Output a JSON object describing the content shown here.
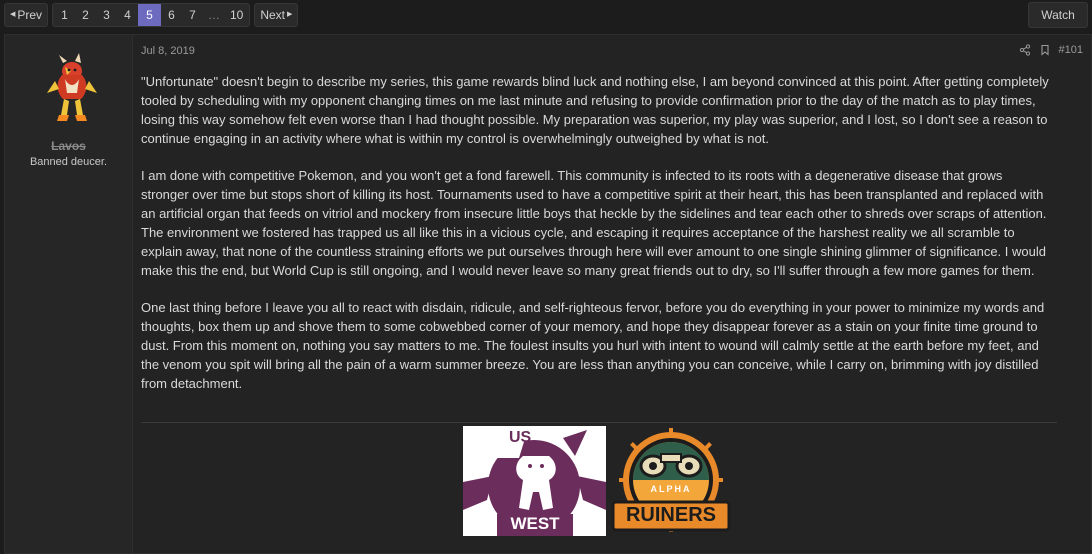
{
  "pager": {
    "prev_label": "Prev",
    "pages": [
      "1",
      "2",
      "3",
      "4",
      "5",
      "6",
      "7",
      "…",
      "10"
    ],
    "current_page": "5",
    "next_label": "Next"
  },
  "watch_label": "Watch",
  "user": {
    "name": "Lavos",
    "title": "Banned deucer."
  },
  "post": {
    "date": "Jul 8, 2019",
    "number": "#101",
    "paragraphs": [
      "\"Unfortunate\" doesn't begin to describe my series, this game rewards blind luck and nothing else, I am beyond convinced at this point. After getting completely tooled by scheduling with my opponent changing times on me last minute and refusing to provide confirmation prior to the day of the match as to play times, losing this way somehow felt even worse than I had thought possible. My preparation was superior, my play was superior, and I lost, so I don't see a reason to continue engaging in an activity where what is within my control is overwhelmingly outweighed by what is not.",
      "I am done with competitive Pokemon, and you won't get a fond farewell. This community is infected to its roots with a degenerative disease that grows stronger over time but stops short of killing its host. Tournaments used to have a competitive spirit at their heart, this has been transplanted and replaced with an artificial organ that feeds on vitriol and mockery from insecure little boys that heckle by the sidelines and tear each other to shreds over scraps of attention. The environment we fostered has trapped us all like this in a vicious cycle, and escaping it requires acceptance of the harshest reality we all scramble to explain away, that none of the countless straining efforts we put ourselves through here will ever amount to one single shining glimmer of significance. I would make this the end, but World Cup is still ongoing, and I would never leave so many great friends out to dry, so I'll suffer through a few more games for them.",
      "One last thing before I leave you all to react with disdain, ridicule, and self-righteous fervor, before you do everything in your power to minimize my words and thoughts, box them up and shove them to some cobwebbed corner of your memory, and hope they disappear forever as a stain on your finite time ground to dust. From this moment on, nothing you say matters to me. The foulest insults you hurl with intent to wound will calmly settle at the earth before my feet, and the venom you spit will bring all the pain of a warm summer breeze. You are less than anything you can conceive, while I carry on, brimming with joy distilled from detachment."
    ]
  },
  "images": {
    "logo1": {
      "top_text": "US",
      "bottom_text": "WEST"
    },
    "logo2": {
      "top_text": "ALPHA",
      "bottom_text": "RUINERS"
    }
  },
  "colors": {
    "accent": "#6d6bbf",
    "logo1_purple": "#6b2d5c",
    "logo2_orange": "#e8892a",
    "logo2_green": "#2f5e4a"
  },
  "icons": [
    "caret-left-icon",
    "caret-right-icon",
    "share-icon",
    "bookmark-icon"
  ]
}
